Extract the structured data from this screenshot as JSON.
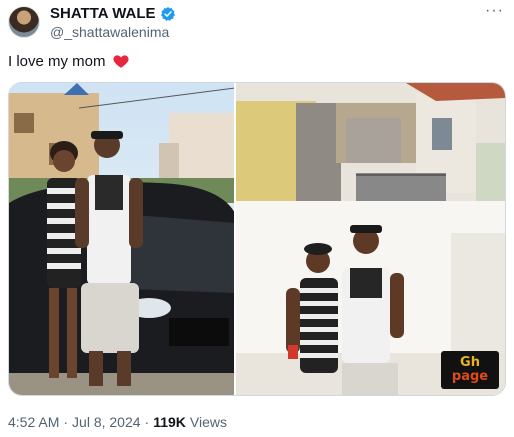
{
  "author": {
    "name": "SHATTA WALE",
    "handle": "@_shattawalenima",
    "verified": true,
    "verified_color": "#1d9bf0"
  },
  "more_label": "···",
  "tweet": {
    "text": "I love my mom",
    "emoji_icon": "red-heart-icon",
    "emoji_color": "#e8263e"
  },
  "media": {
    "count": 2,
    "watermark": {
      "line1": "Gh",
      "line2": "page"
    }
  },
  "meta": {
    "time": "4:52 AM",
    "separator1": "·",
    "date": "Jul 8, 2024",
    "separator2": "·",
    "views_count": "119K",
    "views_label": "Views"
  }
}
